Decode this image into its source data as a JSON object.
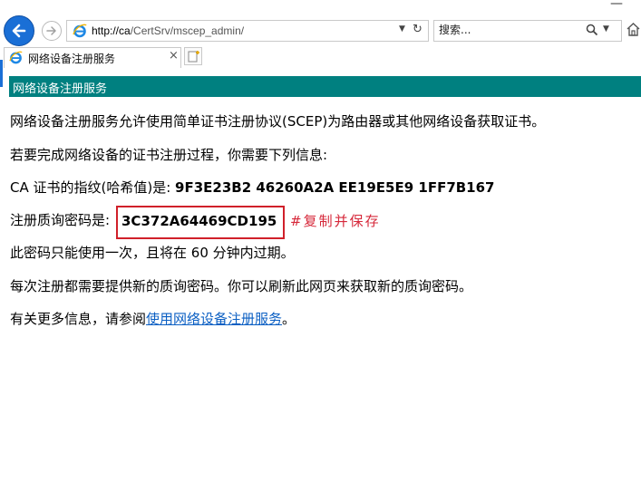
{
  "browser": {
    "url_host": "http://ca",
    "url_path": "/CertSrv/mscep_admin/",
    "search_placeholder": "搜索...",
    "tab_title": "网络设备注册服务",
    "minimize_label": "—"
  },
  "page": {
    "banner": "网络设备注册服务",
    "intro": "网络设备注册服务允许使用简单证书注册协议(SCEP)为路由器或其他网络设备获取证书。",
    "need_info": "若要完成网络设备的证书注册过程，你需要下列信息:",
    "thumbprint_label": "CA 证书的指纹(哈希值)是: ",
    "thumbprint_value": "9F3E23B2 46260A2A EE19E5E9 1FF7B167",
    "challenge_label": "注册质询密码是: ",
    "challenge_value": "3C372A64469CD195",
    "annotation": "#复制并保存",
    "once_note": "此密码只能使用一次，且将在 60 分钟内过期。",
    "new_each": "每次注册都需要提供新的质询密码。你可以刷新此网页来获取新的质询密码。",
    "more_info_prefix": "有关更多信息，请参阅",
    "more_info_link": "使用网络设备注册服务",
    "more_info_suffix": "。"
  },
  "colors": {
    "banner": "#008080",
    "highlight_border": "#d0202a",
    "annotation": "#d6283a",
    "link": "#0b5fc3",
    "back_button": "#1a6fd6"
  },
  "icons": [
    "back-arrow-icon",
    "forward-arrow-icon",
    "ie-logo-icon",
    "dropdown-icon",
    "refresh-icon",
    "search-icon",
    "home-icon",
    "close-icon",
    "new-tab-icon"
  ]
}
